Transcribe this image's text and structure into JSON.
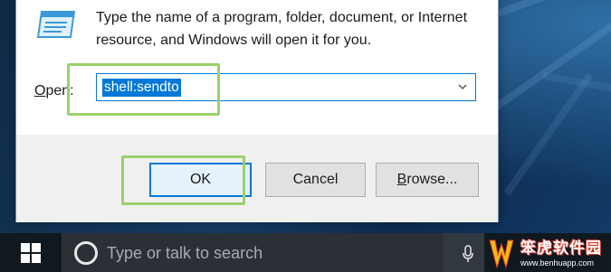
{
  "dialog": {
    "description": "Type the name of a program, folder, document, or Internet resource, and Windows will open it for you.",
    "open_label_underlined": "O",
    "open_label_rest": "pen:",
    "open_value": "shell:sendto",
    "ok_label": "OK",
    "cancel_label": "Cancel",
    "browse_label_underlined": "B",
    "browse_label_rest": "rowse...",
    "highlight_color": "#9bd16a",
    "accent": "#0078d7"
  },
  "taskbar": {
    "search_placeholder": "Type or talk to search"
  },
  "watermark": {
    "title": "笨虎软件园",
    "url": "www.benhuapp.com"
  }
}
